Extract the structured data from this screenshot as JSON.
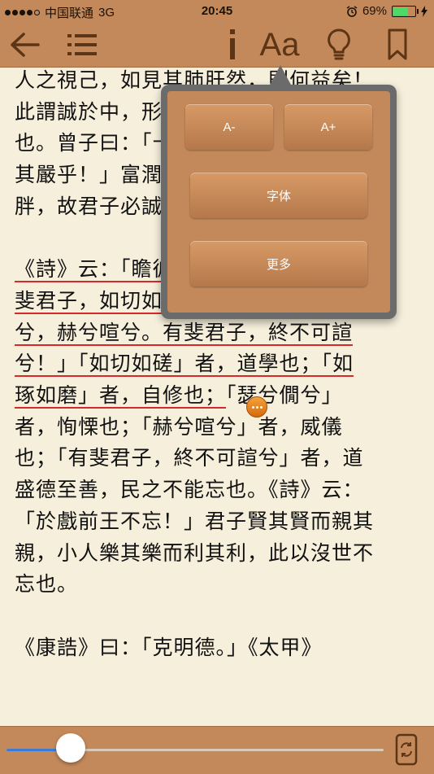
{
  "status": {
    "carrier": "中国联通",
    "network": "3G",
    "time": "20:45",
    "battery_text": "69%",
    "battery_level": 0.69
  },
  "toolbar": {
    "icons": [
      "back-arrow-icon",
      "list-icon",
      "info-icon",
      "font-size-icon",
      "lightbulb-icon",
      "bookmark-icon"
    ],
    "font_label": "Aa"
  },
  "text": {
    "lines": [
      "人之視己，如見其肺肝然，則何益矣！",
      "此謂誠於中，形於外，故君子必慎其獨",
      "也。曾子曰：「十目所視，十手所指，",
      "其嚴乎！」富潤屋，德潤身，心廣體",
      "胖，故君子必誠其意。"
    ],
    "highlight_lines": [
      "《詩》云：「瞻彼淇澳，菉竹猗猗。有",
      "斐君子，如切如磋，如琢如磨。瑟兮僩",
      "兮，赫兮喧兮。有斐君子，終不可諠",
      "兮！」「如切如磋」者，道學也；「如",
      "琢如磨」者，自修也；"
    ],
    "tail_first": "「瑟兮僩兮」",
    "rest_lines": [
      "者，恂慄也；「赫兮喧兮」者，威儀",
      "也；「有斐君子，終不可諠兮」者，道",
      "盛德至善，民之不能忘也。《詩》云：",
      "「於戲前王不忘！」君子賢其賢而親其",
      "親，小人樂其樂而利其利，此以沒世不",
      "忘也。"
    ],
    "last_line": "《康誥》曰：「克明德。」《太甲》"
  },
  "popover": {
    "decrease_label": "A-",
    "increase_label": "A+",
    "font_label": "字体",
    "more_label": "更多"
  },
  "slider": {
    "value": 0.17
  },
  "colors": {
    "bar": "#c4895a",
    "paper": "#f6efdc",
    "highlight": "#d62a2a",
    "accent": "#3a7bd5"
  }
}
